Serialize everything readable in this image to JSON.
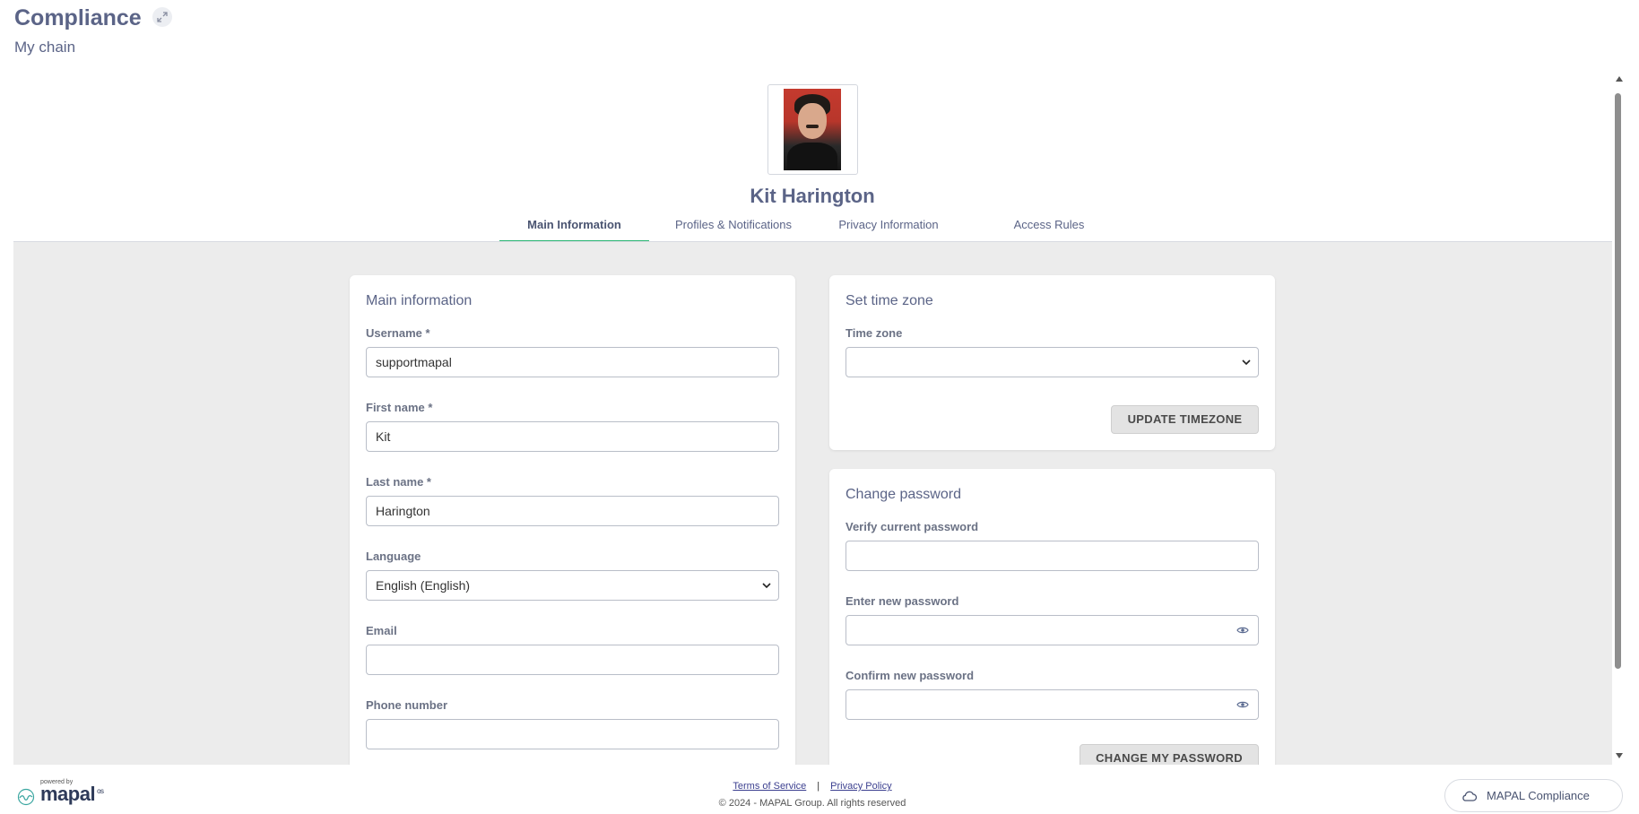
{
  "header": {
    "title": "Compliance",
    "subtitle": "My chain"
  },
  "profile": {
    "name": "Kit Harington"
  },
  "tabs": [
    {
      "label": "Main Information",
      "active": true
    },
    {
      "label": "Profiles & Notifications",
      "active": false
    },
    {
      "label": "Privacy Information",
      "active": false
    },
    {
      "label": "Access Rules",
      "active": false
    }
  ],
  "main_info": {
    "title": "Main information",
    "username": {
      "label": "Username *",
      "value": "supportmapal"
    },
    "first_name": {
      "label": "First name *",
      "value": "Kit"
    },
    "last_name": {
      "label": "Last name *",
      "value": "Harington"
    },
    "language": {
      "label": "Language",
      "value": "English (English)"
    },
    "email": {
      "label": "Email",
      "value": ""
    },
    "phone": {
      "label": "Phone number",
      "value": ""
    }
  },
  "timezone": {
    "title": "Set time zone",
    "label": "Time zone",
    "value": "",
    "button": "UPDATE TIMEZONE"
  },
  "password": {
    "title": "Change password",
    "current_label": "Verify current password",
    "new_label": "Enter new password",
    "confirm_label": "Confirm new password",
    "button": "CHANGE MY PASSWORD"
  },
  "footer": {
    "powered_by": "powered by",
    "brand": "mapal",
    "brand_sup": "os",
    "terms": "Terms of Service",
    "separator": "|",
    "privacy": "Privacy Policy",
    "copyright": "© 2024 - MAPAL Group. All rights reserved",
    "app_switch": "MAPAL Compliance"
  },
  "colors": {
    "accent": "#2bb673",
    "heading": "#5b6487",
    "content_bg": "#ececec"
  }
}
